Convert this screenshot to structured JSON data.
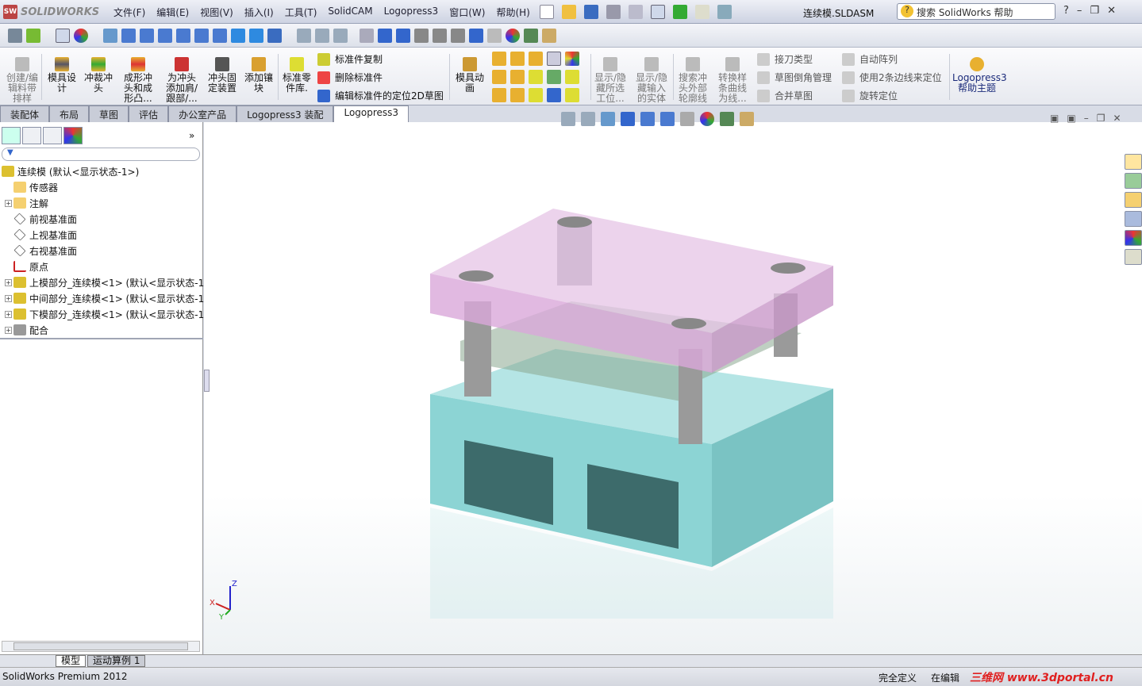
{
  "app": {
    "brand": "SOLIDWORKS",
    "document_title": "连续模.SLDASM",
    "search_placeholder": "搜索 SolidWorks 帮助"
  },
  "menu": [
    "文件(F)",
    "编辑(E)",
    "视图(V)",
    "插入(I)",
    "工具(T)",
    "SolidCAM",
    "Logopress3",
    "窗口(W)",
    "帮助(H)"
  ],
  "ribbon": {
    "buttons": [
      {
        "label": "创建/编辑料带排样",
        "enabled": false
      },
      {
        "label": "模具设计",
        "enabled": true
      },
      {
        "label": "冲裁冲头",
        "enabled": true
      },
      {
        "label": "成形冲头和成形凸...",
        "enabled": true
      },
      {
        "label": "为冲头添加肩/跟部/...",
        "enabled": true
      },
      {
        "label": "冲头固定装置",
        "enabled": true
      },
      {
        "label": "添加镶块",
        "enabled": true
      },
      {
        "label": "标准零件库.",
        "enabled": true
      }
    ],
    "small_buttons": [
      "标准件复制",
      "删除标准件",
      "编辑标准件的定位2D草图"
    ],
    "anim_button": "模具动画",
    "buttons2": [
      {
        "label": "显示/隐藏所选工位..."
      },
      {
        "label": "显示/隐藏输入的实体"
      },
      {
        "label": "搜索冲头外部轮廓线"
      },
      {
        "label": "转换样条曲线为线..."
      }
    ],
    "small_buttons2": [
      "接刀类型",
      "草图倒角管理",
      "合并草图"
    ],
    "small_buttons3": [
      "自动阵列",
      "使用2条边线来定位",
      "旋转定位"
    ],
    "help": {
      "line1": "Logopress3",
      "line2": "帮助主题"
    }
  },
  "tabs": [
    {
      "label": "装配体",
      "active": false
    },
    {
      "label": "布局",
      "active": false
    },
    {
      "label": "草图",
      "active": false
    },
    {
      "label": "评估",
      "active": false
    },
    {
      "label": "办公室产品",
      "active": false
    },
    {
      "label": "Logopress3 装配",
      "active": false
    },
    {
      "label": "Logopress3",
      "active": true
    }
  ],
  "tree": [
    {
      "label": "连续模  (默认<显示状态-1>)",
      "icon": "assembly-icon",
      "expand": false,
      "level": 0
    },
    {
      "label": "传感器",
      "icon": "sensor-folder-icon",
      "expand": false,
      "level": 1
    },
    {
      "label": "注解",
      "icon": "annotation-folder-icon",
      "expand": true,
      "level": 1
    },
    {
      "label": "前视基准面",
      "icon": "plane-icon",
      "expand": false,
      "level": 1
    },
    {
      "label": "上视基准面",
      "icon": "plane-icon",
      "expand": false,
      "level": 1
    },
    {
      "label": "右视基准面",
      "icon": "plane-icon",
      "expand": false,
      "level": 1
    },
    {
      "label": "原点",
      "icon": "origin-icon",
      "expand": false,
      "level": 1
    },
    {
      "label": "上模部分_连续模<1> (默认<显示状态-1",
      "icon": "subassembly-icon",
      "expand": true,
      "level": 1
    },
    {
      "label": "中间部分_连续模<1> (默认<显示状态-1",
      "icon": "subassembly-icon",
      "expand": true,
      "level": 1
    },
    {
      "label": "下模部分_连续模<1> (默认<显示状态-1",
      "icon": "subassembly-icon",
      "expand": true,
      "level": 1
    },
    {
      "label": "配合",
      "icon": "mates-icon",
      "expand": true,
      "level": 1
    }
  ],
  "bottom_tabs": [
    {
      "label": "模型",
      "active": true
    },
    {
      "label": "运动算例 1",
      "active": false
    }
  ],
  "status": {
    "left": "SolidWorks Premium 2012",
    "state": "完全定义",
    "editing": "在编辑",
    "watermark": "三维网 www.3dportal.cn"
  },
  "triad": {
    "x": "X",
    "y": "Y",
    "z": "Z"
  },
  "colors": {
    "top_plate": "#d9a8d9",
    "lower_box": "#7fcfcf",
    "pillar": "#9a9a9a"
  }
}
